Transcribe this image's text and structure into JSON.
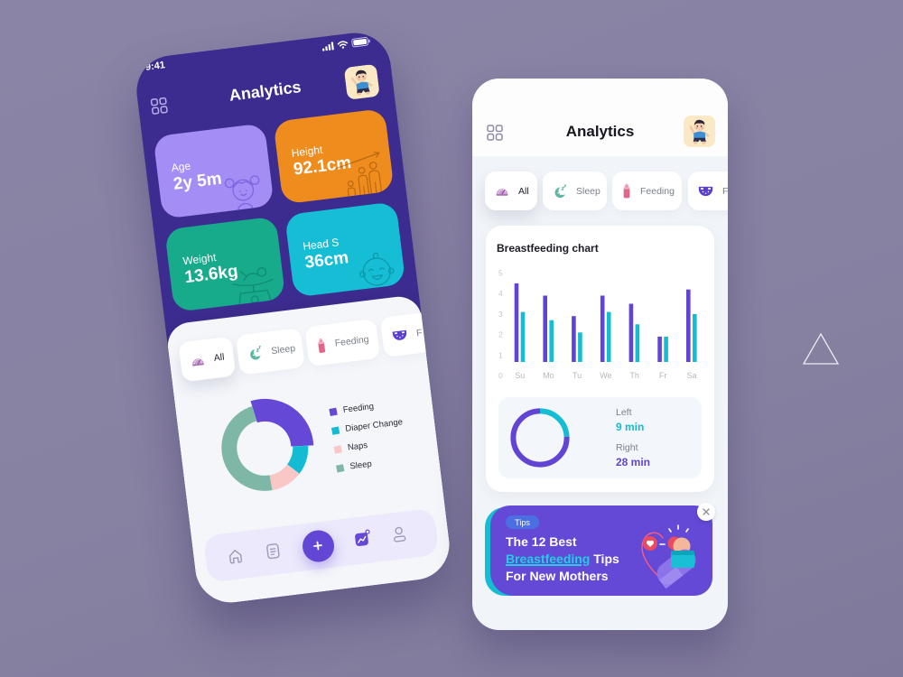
{
  "page": {
    "background": "#8882a3"
  },
  "left_phone": {
    "status_bar": {
      "time": "9:41"
    },
    "header": {
      "title": "Analytics"
    },
    "stat_cards": [
      {
        "label": "Age",
        "value": "2y 5m",
        "color": "#a58df6"
      },
      {
        "label": "Height",
        "value": "92.1cm",
        "color": "#ee8c1e"
      },
      {
        "label": "Weight",
        "value": "13.6kg",
        "color": "#17aa8b"
      },
      {
        "label": "Head S",
        "value": "36cm",
        "color": "#15bed4"
      }
    ],
    "filter_chips": [
      {
        "label": "All",
        "icon": "dashboard-icon",
        "active": true
      },
      {
        "label": "Sleep",
        "icon": "moon-icon"
      },
      {
        "label": "Feeding",
        "icon": "bottle-icon"
      },
      {
        "label": "F",
        "icon": "diaper-icon"
      }
    ],
    "bottom_nav": [
      {
        "icon": "home-icon"
      },
      {
        "icon": "notes-icon"
      },
      {
        "icon": "plus-icon",
        "primary": true
      },
      {
        "icon": "analytics-icon",
        "active": true
      },
      {
        "icon": "profile-icon"
      }
    ]
  },
  "right_phone": {
    "header": {
      "title": "Analytics"
    },
    "filter_chips": [
      {
        "label": "All",
        "icon": "dashboard-icon",
        "active": true
      },
      {
        "label": "Sleep",
        "icon": "moon-icon"
      },
      {
        "label": "Feeding",
        "icon": "bottle-icon"
      },
      {
        "label": "Fe",
        "icon": "diaper-icon"
      }
    ],
    "feeding_summary": {
      "left_label": "Left",
      "left_value": "9 min",
      "right_label": "Right",
      "right_value": "28 min",
      "left_color": "#14bcd4",
      "right_color": "#6244d4"
    },
    "tips_banner": {
      "tag": "Tips",
      "line1": "The 12 Best",
      "highlight": "Breastfeeding",
      "line2_rest": "Tips",
      "line3": "For New Mothers"
    }
  },
  "colors": {
    "primary": "#6346d6",
    "teal": "#14bdd3",
    "header_dark": "#3d2c8f"
  },
  "chart_data": [
    {
      "type": "pie",
      "variant": "donut",
      "labels": [
        "Feeding",
        "Diaper Change",
        "Naps",
        "Sleep"
      ],
      "values": [
        29,
        11,
        12,
        48
      ],
      "colors": [
        "#6548d6",
        "#13bcd3",
        "#f8c7c6",
        "#7fb7a7"
      ],
      "highlighted": "Feeding",
      "legend": "right"
    },
    {
      "type": "bar",
      "title": "Breastfeeding chart",
      "categories": [
        "Su",
        "Mo",
        "Tu",
        "We",
        "Th",
        "Fr",
        "Sa"
      ],
      "series": [
        {
          "color": "#6244d4",
          "values": [
            4.5,
            3.9,
            2.9,
            3.9,
            3.5,
            1.9,
            4.2
          ]
        },
        {
          "color": "#14bcd4",
          "values": [
            3.1,
            2.7,
            2.1,
            3.1,
            2.5,
            1.9,
            3.0
          ]
        }
      ],
      "yticks": [
        0,
        1,
        2,
        3,
        4,
        5
      ],
      "ylim": [
        0,
        5
      ],
      "xlabel": "",
      "ylabel": "",
      "grid": false
    },
    {
      "type": "pie",
      "variant": "donut",
      "labels": [
        "Left",
        "Right"
      ],
      "values": [
        9,
        28
      ],
      "unit": "min",
      "colors": [
        "#14bcd4",
        "#6244d4"
      ]
    }
  ]
}
